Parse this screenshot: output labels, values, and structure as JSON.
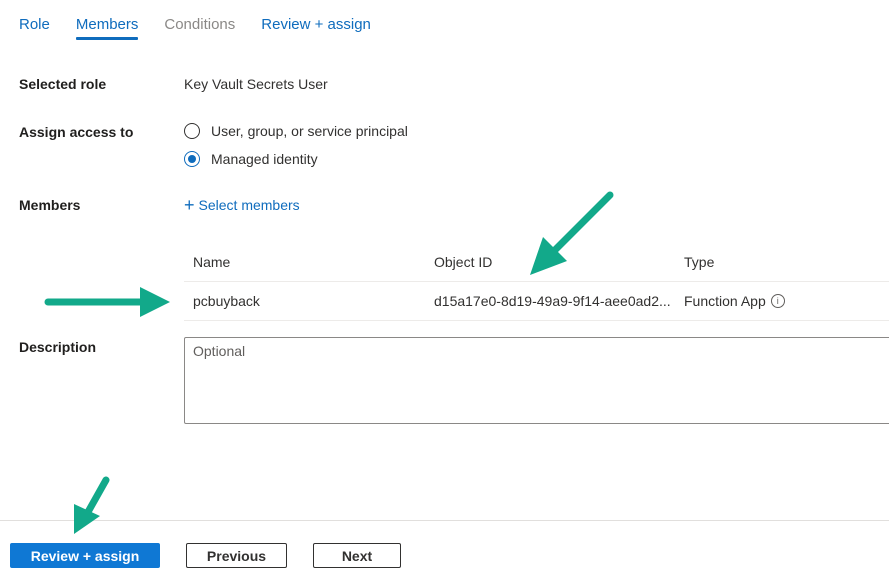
{
  "tabs": [
    {
      "label": "Role",
      "state": "normal"
    },
    {
      "label": "Members",
      "state": "active"
    },
    {
      "label": "Conditions",
      "state": "disabled"
    },
    {
      "label": "Review + assign",
      "state": "normal"
    }
  ],
  "form": {
    "selected_role_label": "Selected role",
    "selected_role_value": "Key Vault Secrets User",
    "assign_access_label": "Assign access to",
    "assign_options": [
      {
        "label": "User, group, or service principal",
        "checked": false
      },
      {
        "label": "Managed identity",
        "checked": true
      }
    ],
    "members_label": "Members",
    "select_members_link": "Select members",
    "description_label": "Description",
    "description_placeholder": "Optional",
    "description_value": ""
  },
  "members_table": {
    "headers": [
      "Name",
      "Object ID",
      "Type"
    ],
    "rows": [
      {
        "name": "pcbuyback",
        "object_id": "d15a17e0-8d19-49a9-9f14-aee0ad2...",
        "type": "Function App"
      }
    ]
  },
  "footer": {
    "review_assign": "Review + assign",
    "previous": "Previous",
    "next": "Next"
  },
  "annotations": {
    "arrow_color": "#12a98a"
  },
  "colors": {
    "accent": "#0f6cbd",
    "primary_button": "#0f78d4"
  }
}
